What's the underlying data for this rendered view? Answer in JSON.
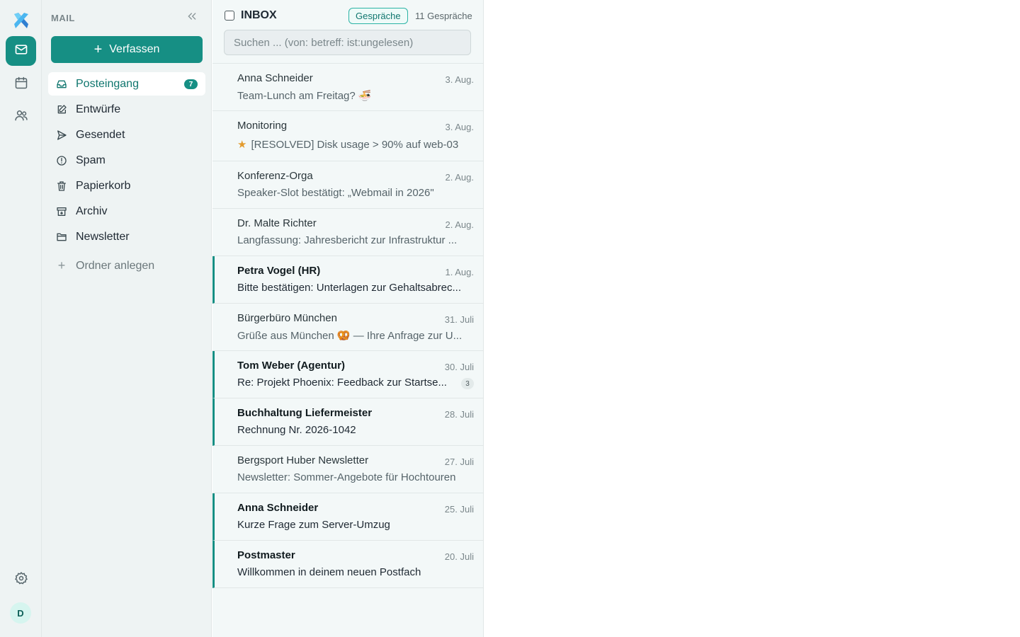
{
  "rail": {
    "logo": "x-logo-icon",
    "items": [
      {
        "icon": "mail-icon",
        "active": true
      },
      {
        "icon": "calendar-icon",
        "active": false
      },
      {
        "icon": "contacts-icon",
        "active": false
      }
    ],
    "settings_icon": "gear-icon",
    "avatar_initial": "D"
  },
  "sidebar": {
    "section_title": "MAIL",
    "compose_label": "Verfassen",
    "folders": [
      {
        "label": "Posteingang",
        "icon": "inbox-icon",
        "count": "7",
        "active": true
      },
      {
        "label": "Entwürfe",
        "icon": "pencil-icon"
      },
      {
        "label": "Gesendet",
        "icon": "send-icon"
      },
      {
        "label": "Spam",
        "icon": "alert-circle-icon"
      },
      {
        "label": "Papierkorb",
        "icon": "trash-icon"
      },
      {
        "label": "Archiv",
        "icon": "archive-icon"
      },
      {
        "label": "Newsletter",
        "icon": "folder-icon"
      }
    ],
    "new_folder_label": "Ordner anlegen"
  },
  "list": {
    "title": "INBOX",
    "view_badge": "Gespräche",
    "conversation_count": "11 Gespräche",
    "search_placeholder": "Suchen ... (von: betreff: ist:ungelesen)",
    "messages": [
      {
        "sender": "Anna Schneider",
        "date": "3. Aug.",
        "subject": "Team-Lunch am Freitag? 🍜",
        "unread": false
      },
      {
        "sender": "Monitoring",
        "date": "3. Aug.",
        "subject": "[RESOLVED] Disk usage > 90% auf web-03",
        "unread": false,
        "starred": true
      },
      {
        "sender": "Konferenz-Orga",
        "date": "2. Aug.",
        "subject": "Speaker-Slot bestätigt: „Webmail in 2026\"",
        "unread": false
      },
      {
        "sender": "Dr. Malte Richter",
        "date": "2. Aug.",
        "subject": "Langfassung: Jahresbericht zur Infrastruktur ...",
        "unread": false
      },
      {
        "sender": "Petra Vogel (HR)",
        "date": "1. Aug.",
        "subject": "Bitte bestätigen: Unterlagen zur Gehaltsabrec...",
        "unread": true
      },
      {
        "sender": "Bürgerbüro München",
        "date": "31. Juli",
        "subject": "Grüße aus München 🥨 — Ihre Anfrage zur U...",
        "unread": false
      },
      {
        "sender": "Tom Weber (Agentur)",
        "date": "30. Juli",
        "subject": "Re: Projekt Phoenix: Feedback zur Startse...",
        "unread": true,
        "thread_count": "3"
      },
      {
        "sender": "Buchhaltung Liefermeister",
        "date": "28. Juli",
        "subject": "Rechnung Nr. 2026-1042",
        "unread": true
      },
      {
        "sender": "Bergsport Huber Newsletter",
        "date": "27. Juli",
        "subject": "Newsletter: Sommer-Angebote für Hochtouren",
        "unread": false
      },
      {
        "sender": "Anna Schneider",
        "date": "25. Juli",
        "subject": "Kurze Frage zum Server-Umzug",
        "unread": true
      },
      {
        "sender": "Postmaster",
        "date": "20. Juli",
        "subject": "Willkommen in deinem neuen Postfach",
        "unread": true
      }
    ]
  },
  "colors": {
    "accent": "#168f84",
    "unread_bar": "#168f84",
    "star": "#e39b2d"
  }
}
